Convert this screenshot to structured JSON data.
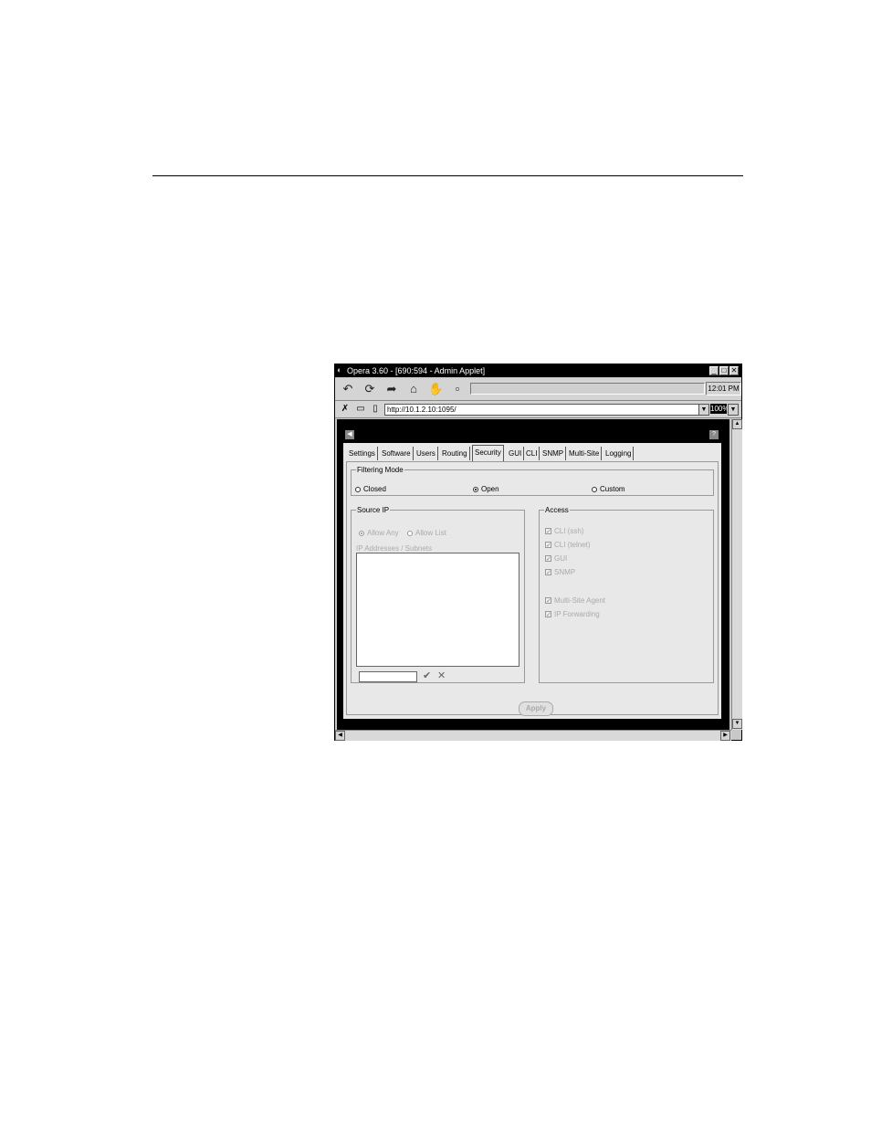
{
  "window": {
    "title": "Opera 3.60 - [690:594 - Admin Applet]",
    "clock": "12:01 PM"
  },
  "address": {
    "url": "http://10.1.2.10:1095/",
    "zoom": "100%"
  },
  "tabs": [
    {
      "label": "Settings",
      "active": false
    },
    {
      "label": "Software",
      "active": false
    },
    {
      "label": "Users",
      "active": false
    },
    {
      "label": "Routing",
      "active": false
    },
    {
      "label": "Security",
      "active": true
    },
    {
      "label": "GUI",
      "active": false
    },
    {
      "label": "CLI",
      "active": false
    },
    {
      "label": "SNMP",
      "active": false
    },
    {
      "label": "Multi-Site",
      "active": false
    },
    {
      "label": "Logging",
      "active": false
    }
  ],
  "filtering": {
    "legend": "Filtering Mode",
    "options": [
      {
        "label": "Closed",
        "selected": false
      },
      {
        "label": "Open",
        "selected": true
      },
      {
        "label": "Custom",
        "selected": false
      }
    ]
  },
  "source_ip": {
    "legend": "Source IP",
    "allow_any": "Allow Any",
    "allow_list": "Allow List",
    "list_label": "IP Addresses / Subnets",
    "input_value": ""
  },
  "access": {
    "legend": "Access",
    "items": [
      {
        "label": "CLI (ssh)",
        "checked": true
      },
      {
        "label": "CLI (telnet)",
        "checked": true
      },
      {
        "label": "GUI",
        "checked": true
      },
      {
        "label": "SNMP",
        "checked": true
      },
      {
        "label": "Multi-Site Agent",
        "checked": true
      },
      {
        "label": "IP Forwarding",
        "checked": true
      }
    ]
  },
  "apply_label": "Apply"
}
